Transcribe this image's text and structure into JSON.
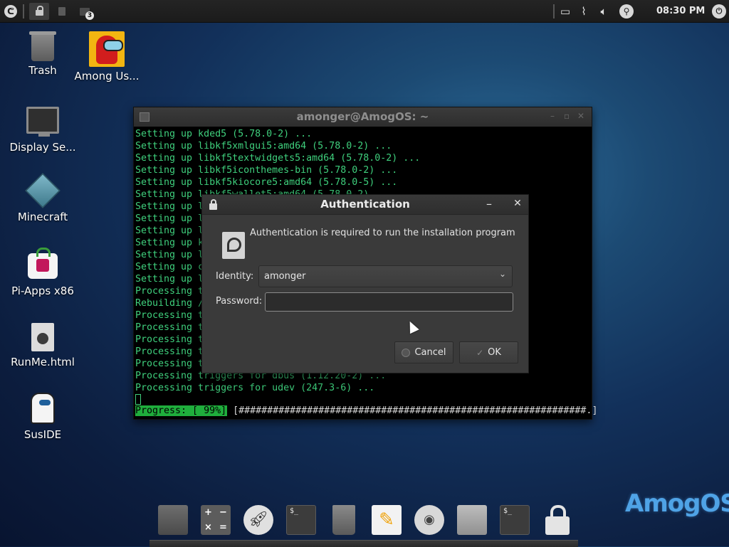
{
  "top_panel": {
    "menu_icon": "menu-logo-icon",
    "workspaces": [
      {
        "icon": "lock-icon",
        "active": true
      },
      {
        "icon": "trash-icon",
        "active": false
      },
      {
        "icon": "terminal-icon",
        "active": false,
        "badge": "3"
      }
    ],
    "tray_icons": [
      "window-icon",
      "attachment-icon",
      "volume-icon",
      "search-icon"
    ],
    "clock": "08:30 PM",
    "power_icon": "power-icon"
  },
  "desktop_icons": [
    {
      "label": "Trash",
      "icon": "trash-icon"
    },
    {
      "label": "Among Us...",
      "icon": "among-us-icon"
    },
    {
      "label": "Display Se...",
      "icon": "monitor-icon"
    },
    {
      "label": "Minecraft",
      "icon": "minecraft-icon"
    },
    {
      "label": "Pi-Apps x86",
      "icon": "pi-apps-icon"
    },
    {
      "label": "RunMe.html",
      "icon": "html-file-icon"
    },
    {
      "label": "SusIDE",
      "icon": "suside-icon"
    }
  ],
  "terminal": {
    "title": "amonger@AmogOS: ~",
    "lines": [
      "Setting up kded5 (5.78.0-2) ...",
      "Setting up libkf5xmlgui5:amd64 (5.78.0-2) ...",
      "Setting up libkf5textwidgets5:amd64 (5.78.0-2) ...",
      "Setting up libkf5iconthemes-bin (5.78.0-2) ...",
      "Setting up libkf5kiocore5:amd64 (5.78.0-5) ...",
      "Setting up libkf5wallet5:amd64 (5.78.0-2) ...",
      "Setting up l",
      "Setting up l",
      "Setting up l",
      "Setting up k",
      "Setting up l",
      "Setting up c",
      "Setting up l",
      "Processing t",
      "Rebuilding /",
      "Processing t",
      "Processing t",
      "Processing t",
      "Processing t",
      "Processing t",
      "Processing triggers for dbus (1.12.20-2) ...",
      "Processing triggers for udev (247.3-6) ..."
    ],
    "progress_label": "Progress: [ 99%]",
    "progress_bar": " [#############################################################.]",
    "progress_percent": 99
  },
  "auth_dialog": {
    "title": "Authentication",
    "minimize": "–",
    "close": "✕",
    "message": "Authentication is required to run the installation program",
    "identity_label": "Identity:",
    "identity_value": "amonger",
    "password_label": "Password:",
    "password_value": "",
    "cancel_label": "Cancel",
    "ok_label": "OK"
  },
  "dock": {
    "items": [
      "spreadsheet-icon",
      "calculator-icon",
      "launcher-icon",
      "terminal-icon",
      "trash-icon",
      "text-editor-icon",
      "browser-icon",
      "file-manager-icon",
      "terminal-icon",
      "lock-screen-icon"
    ],
    "calculator_keys": [
      "+",
      "−",
      "×",
      "="
    ],
    "terminal_prompt": "$_"
  },
  "logo_text": "AmogOS"
}
